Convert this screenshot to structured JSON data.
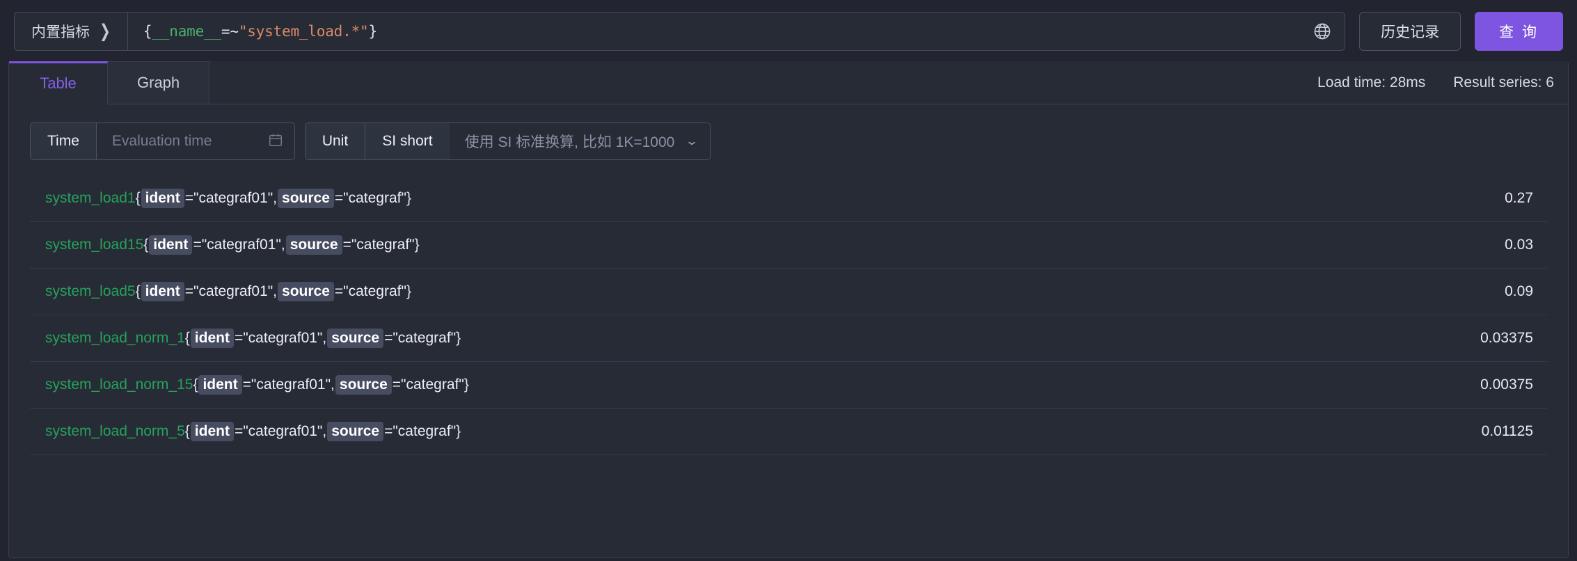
{
  "topbar": {
    "metric_picker_label": "内置指标",
    "metric_picker_chevron": "chevron-right-icon",
    "query": {
      "open_brace": "{",
      "name": "__name__",
      "operator": "=~",
      "value": "\"system_load.*\"",
      "close_brace": "}",
      "full": "{__name__=~\"system_load.*\"}"
    },
    "globe_icon": "globe-icon",
    "history_label": "历史记录",
    "query_button_label": "查 询",
    "accent_color": "#7d55e0"
  },
  "tabs": [
    {
      "label": "Table",
      "active": true
    },
    {
      "label": "Graph",
      "active": false
    }
  ],
  "status": {
    "load_time": "Load time: 28ms",
    "result_series": "Result series: 6"
  },
  "controls": {
    "time_label": "Time",
    "time_placeholder": "Evaluation time",
    "time_value": "",
    "calendar_icon": "calendar-icon",
    "unit_label": "Unit",
    "unit_value": "SI short",
    "unit_description": "使用 SI 标准换算, 比如 1K=1000",
    "chevron_icon": "chevron-down-icon"
  },
  "table": {
    "rows": [
      {
        "metric": "system_load1",
        "labels": [
          {
            "key": "ident",
            "value": "\"categraf01\""
          },
          {
            "key": "source",
            "value": "\"categraf\""
          }
        ],
        "value": "0.27"
      },
      {
        "metric": "system_load15",
        "labels": [
          {
            "key": "ident",
            "value": "\"categraf01\""
          },
          {
            "key": "source",
            "value": "\"categraf\""
          }
        ],
        "value": "0.03"
      },
      {
        "metric": "system_load5",
        "labels": [
          {
            "key": "ident",
            "value": "\"categraf01\""
          },
          {
            "key": "source",
            "value": "\"categraf\""
          }
        ],
        "value": "0.09"
      },
      {
        "metric": "system_load_norm_1",
        "labels": [
          {
            "key": "ident",
            "value": "\"categraf01\""
          },
          {
            "key": "source",
            "value": "\"categraf\""
          }
        ],
        "value": "0.03375"
      },
      {
        "metric": "system_load_norm_15",
        "labels": [
          {
            "key": "ident",
            "value": "\"categraf01\""
          },
          {
            "key": "source",
            "value": "\"categraf\""
          }
        ],
        "value": "0.00375"
      },
      {
        "metric": "system_load_norm_5",
        "labels": [
          {
            "key": "ident",
            "value": "\"categraf01\""
          },
          {
            "key": "source",
            "value": "\"categraf\""
          }
        ],
        "value": "0.01125"
      }
    ]
  }
}
